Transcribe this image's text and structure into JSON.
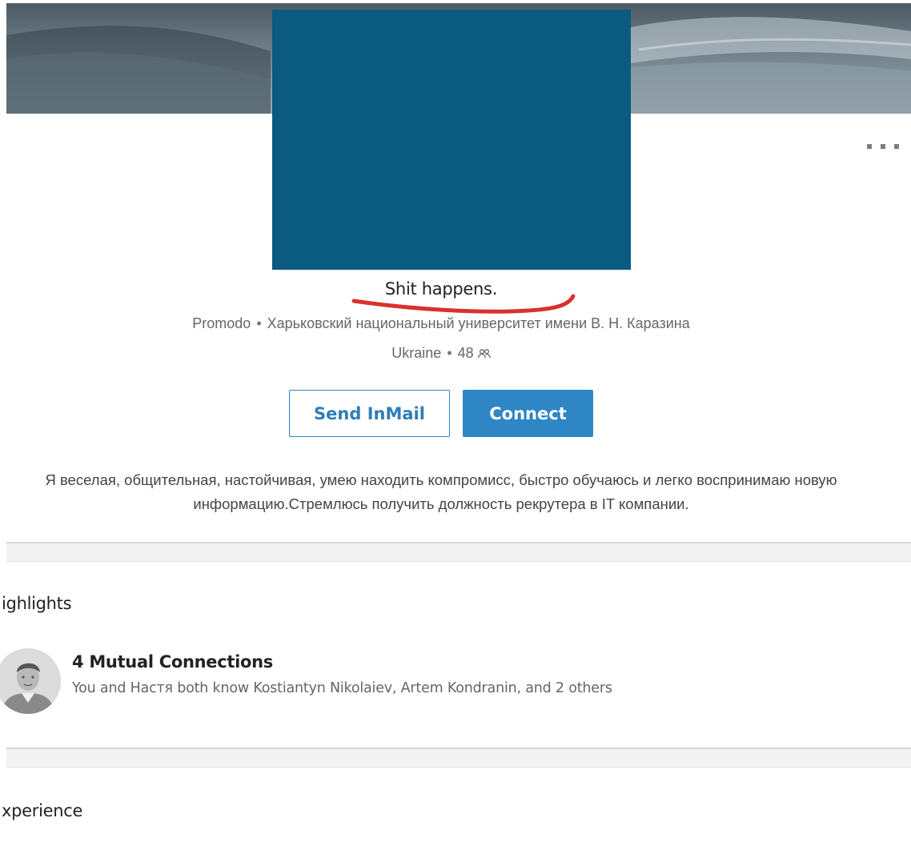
{
  "profile": {
    "headline": "Shit happens.",
    "company": "Promodo",
    "school": "Харьковский национальный университет имени В. Н. Каразина",
    "location": "Ukraine",
    "connections": "48",
    "separator": "•",
    "summary": "Я веселая, общительная, настойчивая, умею находить компромисс, быстро обучаюсь и легко воспринимаю новую информацию.Стремлюсь получить должность рекрутера в IT компании.",
    "photo_color": "#0b5a7f"
  },
  "actions": {
    "send_inmail_label": "Send InMail",
    "connect_label": "Connect",
    "more_icon": "more-dots-icon"
  },
  "highlights": {
    "title": "ighlights",
    "mutual_title": "4 Mutual Connections",
    "mutual_desc": "You and Настя both know Kostiantyn Nikolaiev, Artem Kondranin, and 2 others"
  },
  "experience": {
    "title": "xperience"
  },
  "colors": {
    "accent": "#2f86c4",
    "annotation": "#d9322b"
  }
}
